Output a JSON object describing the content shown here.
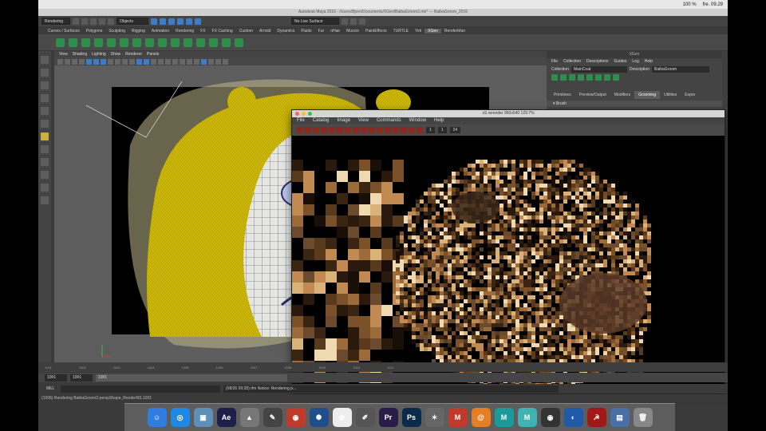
{
  "menubar": {
    "app_glyph": "",
    "battery": "100 %",
    "time": "fre. 09.29"
  },
  "maya": {
    "title": "Autodesk Maya 2016 - /Users/Bjorn/Documents/XGen/BaibaGroom2.mb* --- BaibaGroom_2016",
    "menuset": "Rendering",
    "objects_dropdown": "Objects",
    "live_surface": "No Live Surface",
    "shelf_tabs": [
      "Curves / Surfaces",
      "Polygons",
      "Sculpting",
      "Rigging",
      "Animation",
      "Rendering",
      "FX",
      "FX Caching",
      "Custom",
      "Arnold",
      "Dynamics",
      "Fluids",
      "Fur",
      "nHair",
      "Muscle",
      "PaintEffects",
      "TURTLE",
      "Yeti",
      "XGen",
      "RenderMan"
    ],
    "active_shelf_tab": "XGen",
    "viewport_menu": [
      "View",
      "Shading",
      "Lighting",
      "Show",
      "Renderer",
      "Panels"
    ]
  },
  "xgen": {
    "title": "XGen",
    "menu": [
      "File",
      "Collection",
      "Descriptions",
      "Guides",
      "Log",
      "Help"
    ],
    "collection_label": "Collection",
    "collection_value": "MainCoat",
    "description_label": "Description",
    "description_value": "BaibaGroom",
    "tabs": [
      "Primitives",
      "Preview/Output",
      "Modifiers",
      "Grooming",
      "Utilities",
      "Expre"
    ],
    "active_tab": "Grooming",
    "section": "Brush"
  },
  "render_window": {
    "title": "xS rerender 960x540 129.7%",
    "menu": [
      "File",
      "Catalog",
      "Image",
      "View",
      "Commands",
      "Window",
      "Help"
    ],
    "frame_fields": [
      "1",
      "1",
      "24"
    ]
  },
  "timeline": {
    "ticks": [
      "1001",
      "1002",
      "1003",
      "1004",
      "1005",
      "1006",
      "1007",
      "1008",
      "1009",
      "1010",
      "1011"
    ],
    "current_frame": "1001",
    "start_field": "1001",
    "range_start": "1001",
    "range_label": "1001"
  },
  "command_line": {
    "mel_label": "MEL",
    "output": "(08/26 09:28) rfm Notice: Rendering p..."
  },
  "help_line": "(1006) Rendering BaibaGroom2.perspShape_RenderNS.1001",
  "dock_apps": [
    {
      "name": "finder",
      "glyph": "☺",
      "color": "#2f7de1"
    },
    {
      "name": "safari",
      "glyph": "◎",
      "color": "#1e88e5"
    },
    {
      "name": "preview",
      "glyph": "▣",
      "color": "#5d8fb8"
    },
    {
      "name": "after-effects",
      "glyph": "Ae",
      "color": "#1c1f4a"
    },
    {
      "name": "compressor",
      "glyph": "▲",
      "color": "#777"
    },
    {
      "name": "tool",
      "glyph": "✎",
      "color": "#444"
    },
    {
      "name": "resolve",
      "glyph": "◉",
      "color": "#c0392b"
    },
    {
      "name": "cinema",
      "glyph": "✺",
      "color": "#1f4f8b"
    },
    {
      "name": "photos",
      "glyph": "✿",
      "color": "#eee"
    },
    {
      "name": "paint",
      "glyph": "✐",
      "color": "#555"
    },
    {
      "name": "premiere",
      "glyph": "Pr",
      "color": "#2a1c4a"
    },
    {
      "name": "photoshop",
      "glyph": "Ps",
      "color": "#0c2a4a"
    },
    {
      "name": "mudbox",
      "glyph": "✶",
      "color": "#666"
    },
    {
      "name": "maya-old",
      "glyph": "M",
      "color": "#c0392b"
    },
    {
      "name": "houdini",
      "glyph": "@",
      "color": "#e67e22"
    },
    {
      "name": "maya-2016",
      "glyph": "M",
      "color": "#1a9a9a"
    },
    {
      "name": "maya",
      "glyph": "M",
      "color": "#3fb3b3"
    },
    {
      "name": "eye",
      "glyph": "◉",
      "color": "#333"
    },
    {
      "name": "blender",
      "glyph": "◐",
      "color": "#1e5aa8"
    },
    {
      "name": "archive",
      "glyph": "☭",
      "color": "#a01818"
    },
    {
      "name": "files",
      "glyph": "▤",
      "color": "#4a6fa5"
    },
    {
      "name": "trash",
      "glyph": "🗑",
      "color": "#888"
    }
  ]
}
